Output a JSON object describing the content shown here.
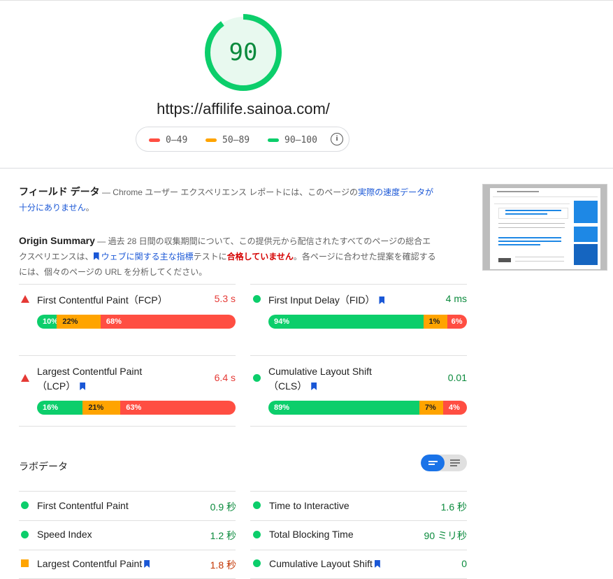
{
  "score": {
    "value": "90",
    "url": "https://affilife.sainoa.com/"
  },
  "legend": [
    {
      "label": "0–49",
      "color": "#ff4e42"
    },
    {
      "label": "50–89",
      "color": "#ffa400"
    },
    {
      "label": "90–100",
      "color": "#0cce6b"
    }
  ],
  "field": {
    "title": "フィールド データ",
    "desc_prefix": "— Chrome ユーザー エクスペリエンス レポートには、このページの",
    "desc_link": "実際の速度データが十分にありません",
    "desc_suffix": "。"
  },
  "origin": {
    "title": "Origin Summary",
    "desc1": "— 過去 28 日間の収集期間について、この提供元から配信されたすべてのページの総合エクスペリエンスは、",
    "link": "ウェブに関する主な指標",
    "desc2": "テストに",
    "fail": "合格していません",
    "desc3": "。各ページに合わせた提案を確認するには、個々のページの URL を分析してください。"
  },
  "field_metrics": [
    {
      "name": "First Contentful Paint（FCP）",
      "value": "5.3 s",
      "status": "poor",
      "dist": [
        "10%",
        "22%",
        "68%"
      ]
    },
    {
      "name": "First Input Delay（FID）",
      "value": "4 ms",
      "status": "good",
      "dist": [
        "94%",
        "1%",
        "6%"
      ]
    },
    {
      "name": "Largest Contentful Paint",
      "name2": "（LCP）",
      "value": "6.4 s",
      "status": "poor",
      "dist": [
        "16%",
        "21%",
        "63%"
      ]
    },
    {
      "name": "Cumulative Layout Shift",
      "name2": "（CLS）",
      "value": "0.01",
      "status": "good",
      "dist": [
        "89%",
        "7%",
        "4%"
      ]
    }
  ],
  "lab": {
    "title": "ラボデータ",
    "metrics": [
      {
        "name": "First Contentful Paint",
        "value": "0.9 秒",
        "status": "good"
      },
      {
        "name": "Time to Interactive",
        "value": "1.6 秒",
        "status": "good"
      },
      {
        "name": "Speed Index",
        "value": "1.2 秒",
        "status": "good"
      },
      {
        "name": "Total Blocking Time",
        "value": "90 ミリ秒",
        "status": "good"
      },
      {
        "name": "Largest Contentful Paint",
        "value": "1.8 秒",
        "status": "average"
      },
      {
        "name": "Cumulative Layout Shift",
        "value": "0",
        "status": "good"
      }
    ]
  },
  "colors": {
    "good": "#0cce6b",
    "average": "#ffa400",
    "poor": "#ff4e42",
    "good_text": "#0a8a3c",
    "average_text": "#c33300",
    "poor_text": "#e53935",
    "link": "#1a57d6"
  }
}
